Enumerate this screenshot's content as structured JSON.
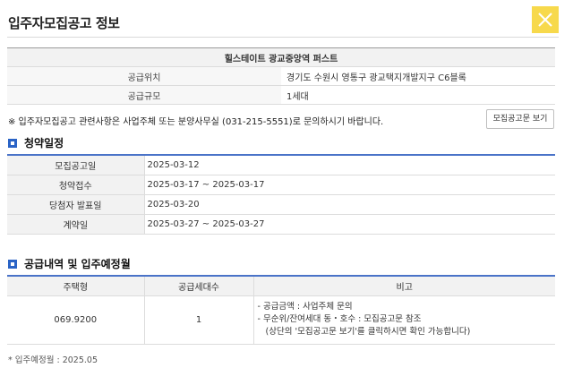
{
  "header": {
    "title": "입주자모집공고 정보",
    "close_icon": "close-icon"
  },
  "info": {
    "complex_name": "힐스테이트 광교중앙역 퍼스트",
    "rows": [
      {
        "label": "공급위치",
        "value": "경기도 수원시 영통구 광교택지개발지구 C6블록"
      },
      {
        "label": "공급규모",
        "value": "1세대"
      }
    ]
  },
  "notice": {
    "text": "※ 입주자모집공고 관련사항은 사업주체 또는 분양사무실 (031-215-5551)로 문의하시기 바랍니다.",
    "button_label": "모집공고문 보기"
  },
  "schedule": {
    "title": "청약일정",
    "rows": [
      {
        "label": "모집공고일",
        "value": "2025-03-12"
      },
      {
        "label": "청약접수",
        "value": "2025-03-17 ~ 2025-03-17"
      },
      {
        "label": "당첨자 발표일",
        "value": "2025-03-20"
      },
      {
        "label": "계약일",
        "value": "2025-03-27 ~ 2025-03-27"
      }
    ]
  },
  "supply": {
    "title": "공급내역 및 입주예정월",
    "columns": [
      "주택형",
      "공급세대수",
      "비고"
    ],
    "rows": [
      {
        "type": "069.9200",
        "units": "1",
        "notes": [
          "-  공급금액 : 사업주체 문의",
          "-  무순위/잔여세대 동・호수 : 모집공고문 참조",
          "   (상단의 '모집공고문 보기'를 클릭하시면 확인 가능합니다)"
        ]
      }
    ]
  },
  "footnote": "* 입주예정월 : 2025.05",
  "colors": {
    "accent": "#2a63c6",
    "close_bg": "#f7d94c",
    "table_rule": "#4a73c8"
  }
}
